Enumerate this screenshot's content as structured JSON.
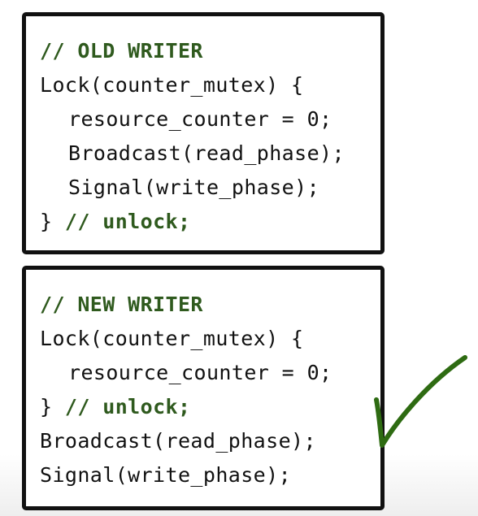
{
  "old_writer": {
    "comment": "// OLD WRITER",
    "lock_line": "Lock(counter_mutex) {",
    "reset_line": "resource_counter = 0;",
    "broadcast_line": "Broadcast(read_phase);",
    "signal_line": "Signal(write_phase);",
    "close_brace": "} ",
    "unlock_comment": "// unlock;"
  },
  "new_writer": {
    "comment": "// NEW WRITER",
    "lock_line": "Lock(counter_mutex) {",
    "reset_line": "resource_counter = 0;",
    "close_brace": "} ",
    "unlock_comment": "// unlock;",
    "broadcast_line": "Broadcast(read_phase);",
    "signal_line": "Signal(write_phase);"
  },
  "annotation": {
    "icon": "checkmark-icon",
    "color": "#2e6b12"
  },
  "colors": {
    "comment": "#2f5a1e",
    "code": "#111111",
    "border": "#111111"
  }
}
